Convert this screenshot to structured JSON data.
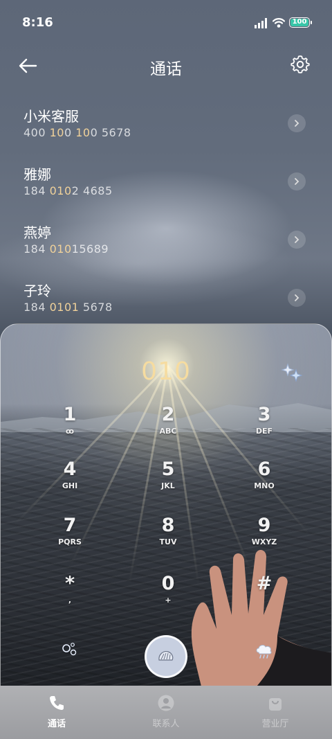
{
  "status_bar": {
    "time": "8:16",
    "battery": "100"
  },
  "header": {
    "title": "通话",
    "back_icon": "arrow-left-icon",
    "settings_icon": "gear-icon"
  },
  "contacts": [
    {
      "name": "小米客服",
      "number_parts": [
        "400 ",
        "10",
        "0 ",
        "10",
        "0 5678"
      ]
    },
    {
      "name": "雅娜",
      "number_parts": [
        "184 ",
        "010",
        "2 4685"
      ]
    },
    {
      "name": "燕婷",
      "number_parts": [
        "184 ",
        "010",
        "15689"
      ]
    },
    {
      "name": "子玲",
      "number_parts": [
        "184 ",
        "0101",
        " 5678"
      ]
    }
  ],
  "dialpad": {
    "entered_number": "010",
    "keys": [
      {
        "digit": "1",
        "letters": "ꝏ"
      },
      {
        "digit": "2",
        "letters": "ABC"
      },
      {
        "digit": "3",
        "letters": "DEF"
      },
      {
        "digit": "4",
        "letters": "GHI"
      },
      {
        "digit": "5",
        "letters": "JKL"
      },
      {
        "digit": "6",
        "letters": "MNO"
      },
      {
        "digit": "7",
        "letters": "PQRS"
      },
      {
        "digit": "8",
        "letters": "TUV"
      },
      {
        "digit": "9",
        "letters": "WXYZ"
      },
      {
        "digit": "*",
        "letters": ","
      },
      {
        "digit": "0",
        "letters": "+"
      },
      {
        "digit": "#",
        "letters": ""
      }
    ]
  },
  "colors": {
    "highlight": "#f1d29a",
    "entered": "#f6dca0",
    "call_button": "#c7cfe0"
  },
  "nav": [
    {
      "label": "通话",
      "icon": "phone-icon",
      "active": true
    },
    {
      "label": "联系人",
      "icon": "person-icon",
      "active": false
    },
    {
      "label": "营业厅",
      "icon": "bag-icon",
      "active": false
    }
  ]
}
